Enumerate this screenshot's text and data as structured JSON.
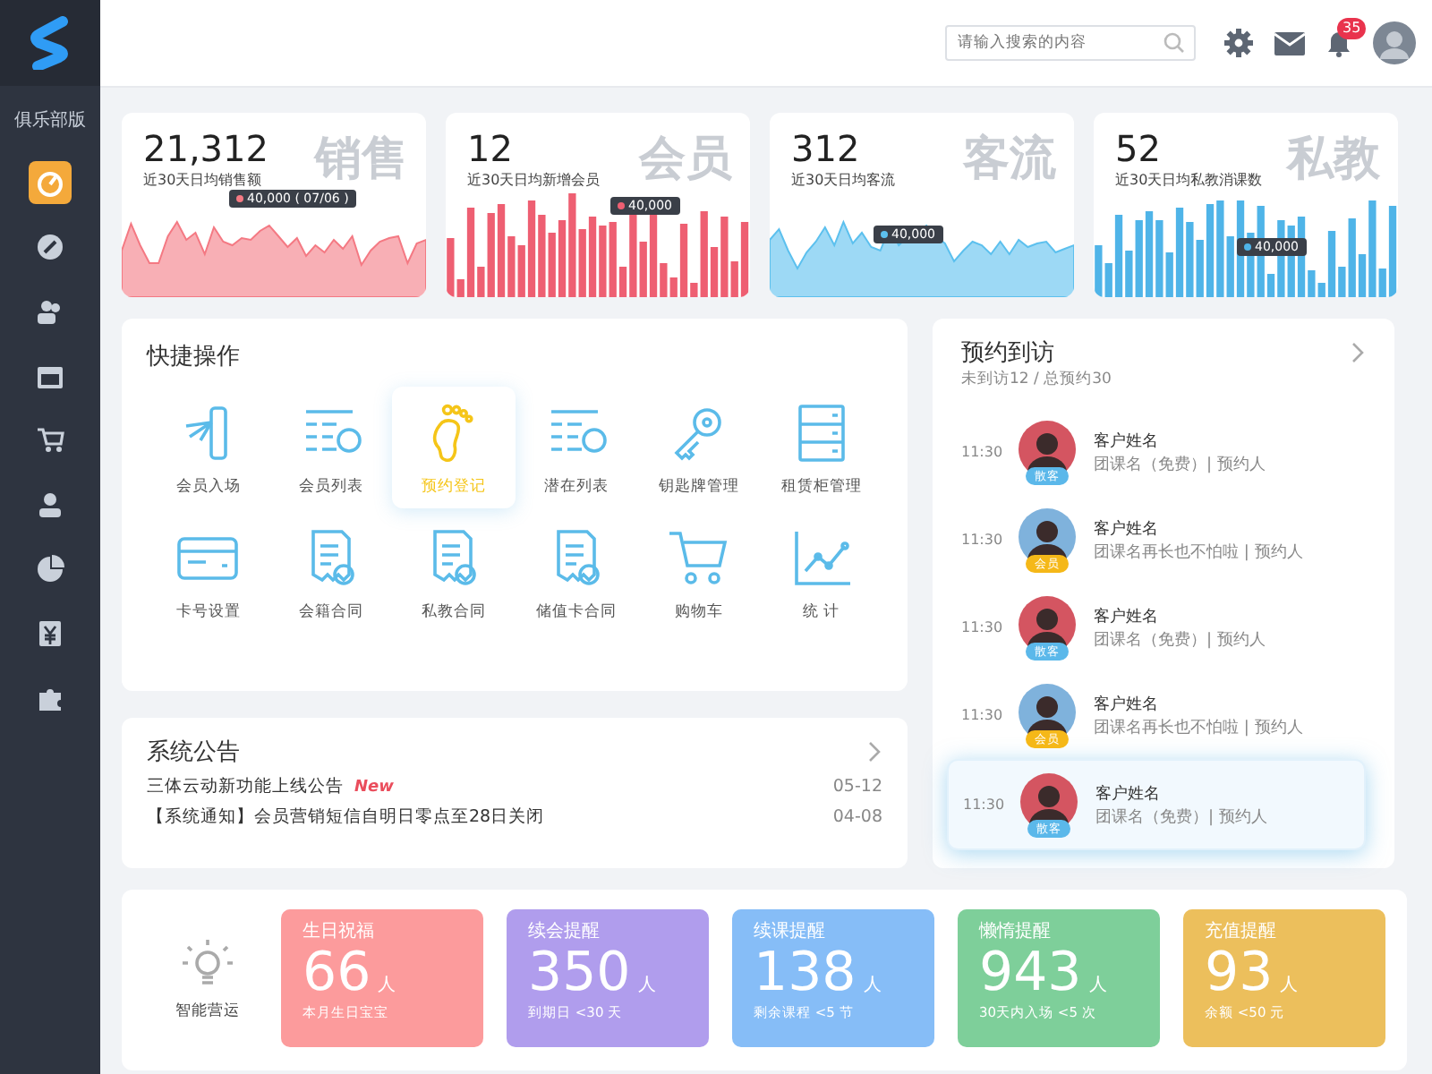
{
  "sidebar": {
    "brand": "俱乐部版",
    "items": [
      {
        "selected": true
      },
      {
        "selected": false
      },
      {
        "selected": false
      },
      {
        "selected": false
      },
      {
        "selected": false
      },
      {
        "selected": false
      },
      {
        "selected": false
      },
      {
        "selected": false
      },
      {
        "selected": false
      }
    ]
  },
  "header": {
    "search": {
      "placeholder": "请输入搜索的内容"
    },
    "notification_count": "35"
  },
  "stats": [
    {
      "value": "21,312",
      "caption": "近30天日均销售额",
      "watermark": "销售",
      "kind": "area",
      "color": "#f47983",
      "tooltip": "40,000 ( 07/06 )"
    },
    {
      "value": "12",
      "caption": "近30天日均新增会员",
      "watermark": "会员",
      "kind": "bar",
      "color": "#ee5f72",
      "tooltip": "40,000"
    },
    {
      "value": "312",
      "caption": "近30天日均客流",
      "watermark": "客流",
      "kind": "area",
      "color": "#5cc0ee",
      "tooltip": "40,000"
    },
    {
      "value": "52",
      "caption": "近30天日均私教消课数",
      "watermark": "私教",
      "kind": "bar",
      "color": "#4fb4e8",
      "tooltip": "40,000"
    }
  ],
  "quick_actions": {
    "title": "快捷操作",
    "items": [
      {
        "label": "会员入场",
        "selected": false
      },
      {
        "label": "会员列表",
        "selected": false
      },
      {
        "label": "预约登记",
        "selected": true
      },
      {
        "label": "潜在列表",
        "selected": false
      },
      {
        "label": "钥匙牌管理",
        "selected": false
      },
      {
        "label": "租赁柜管理",
        "selected": false
      },
      {
        "label": "卡号设置",
        "selected": false
      },
      {
        "label": "会籍合同",
        "selected": false
      },
      {
        "label": "私教合同",
        "selected": false
      },
      {
        "label": "储值卡合同",
        "selected": false
      },
      {
        "label": "购物车",
        "selected": false
      },
      {
        "label": "统 计",
        "selected": false
      }
    ]
  },
  "notices": {
    "title": "系统公告",
    "items": [
      {
        "text": "三体云动新功能上线公告",
        "new_tag": "New",
        "date": "05-12"
      },
      {
        "text": "【系统通知】会员营销短信自明日零点至28日关闭",
        "date": "04-08"
      }
    ]
  },
  "visits": {
    "title": "预约到访",
    "summary": "未到访12 / 总预约30",
    "items": [
      {
        "time": "11:30",
        "name": "客户姓名",
        "detail": "团课名（免费）| 预约人",
        "badge": "散客",
        "color": "#5bb8ea",
        "selected": false
      },
      {
        "time": "11:30",
        "name": "客户姓名",
        "detail": "团课名再长也不怕啦 | 预约人",
        "badge": "会员",
        "color": "#f5b818",
        "selected": false
      },
      {
        "time": "11:30",
        "name": "客户姓名",
        "detail": "团课名（免费）| 预约人",
        "badge": "散客",
        "color": "#5bb8ea",
        "selected": false
      },
      {
        "time": "11:30",
        "name": "客户姓名",
        "detail": "团课名再长也不怕啦 | 预约人",
        "badge": "会员",
        "color": "#f5b818",
        "selected": false
      },
      {
        "time": "11:30",
        "name": "客户姓名",
        "detail": "团课名（免费）| 预约人",
        "badge": "散客",
        "color": "#5bb8ea",
        "selected": true
      }
    ]
  },
  "marketing": {
    "title": "智能营运",
    "cards": [
      {
        "title": "生日祝福",
        "value": "66",
        "unit": "人",
        "note": "本月生日宝宝",
        "color": "#fc9b9c"
      },
      {
        "title": "续会提醒",
        "value": "350",
        "unit": "人",
        "note": "到期日 <30 天",
        "color": "#b09ded"
      },
      {
        "title": "续课提醒",
        "value": "138",
        "unit": "人",
        "note": "剩余课程 <5 节",
        "color": "#86bdf7"
      },
      {
        "title": "懒惰提醒",
        "value": "943",
        "unit": "人",
        "note": "30天内入场 <5 次",
        "color": "#7ecf9a"
      },
      {
        "title": "充值提醒",
        "value": "93",
        "unit": "人",
        "note": "余额 <50 元",
        "color": "#ecbf5c"
      }
    ]
  }
}
